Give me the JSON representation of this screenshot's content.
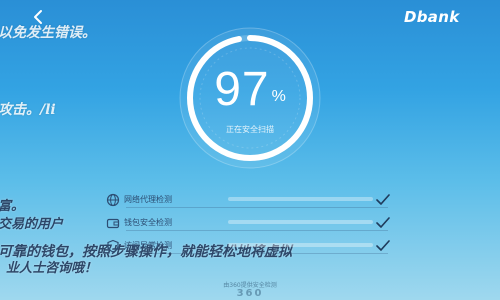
{
  "topbar": {
    "brand": "Dbank"
  },
  "overlay_text": {
    "line1": "以免发生错误。",
    "line2": "攻击。/li",
    "line3": "富。",
    "line4": "交易的用户",
    "line5": "可靠的钱包，按照步骤操作，就能轻松地将虚拟",
    "line6": "业人士咨询哦！"
  },
  "scan": {
    "score": "97",
    "unit": "%",
    "status": "正在安全扫描",
    "progress": 0.97
  },
  "checks": [
    {
      "label": "网络代理检测",
      "done": true
    },
    {
      "label": "钱包安全检测",
      "done": true
    },
    {
      "label": "访问异常检测",
      "done": true
    }
  ],
  "footer": {
    "caption": "由360提供安全检测",
    "logo": "360"
  },
  "colors": {
    "background_top": "#2a8fd6",
    "background_bottom": "#9fd8ee",
    "gauge_stroke": "#ffffff",
    "label_text": "#2c4d73"
  }
}
